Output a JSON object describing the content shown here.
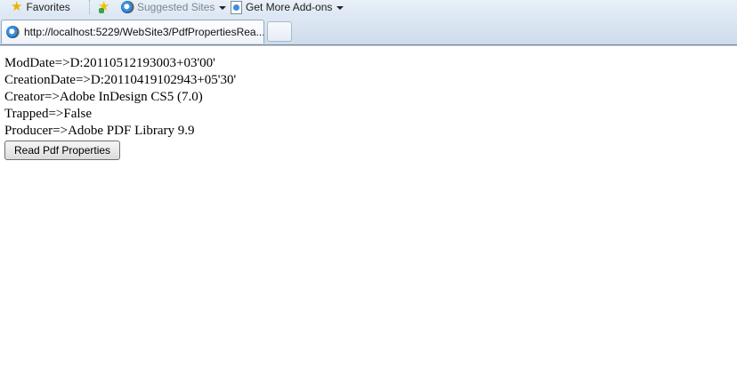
{
  "favorites_bar": {
    "favorites_label": "Favorites",
    "suggested_sites_label": "Suggested Sites",
    "get_more_addons_label": "Get More Add-ons"
  },
  "tabs": [
    {
      "label": "http://localhost:5229/WebSite3/PdfPropertiesRea...",
      "active": true
    }
  ],
  "page": {
    "properties": [
      "ModDate=>D:20110512193003+03'00'",
      "CreationDate=>D:20110419102943+05'30'",
      "Creator=>Adobe InDesign CS5 (7.0)",
      "Trapped=>False",
      "Producer=>Adobe PDF Library 9.9"
    ],
    "read_button_label": "Read Pdf Properties"
  },
  "icons": {
    "favorites": "star-icon",
    "add_to_favorites": "add-favorites-icon",
    "suggested_sites": "ie-icon",
    "get_more_addons": "page-icon",
    "tab_icon": "ie-icon"
  }
}
